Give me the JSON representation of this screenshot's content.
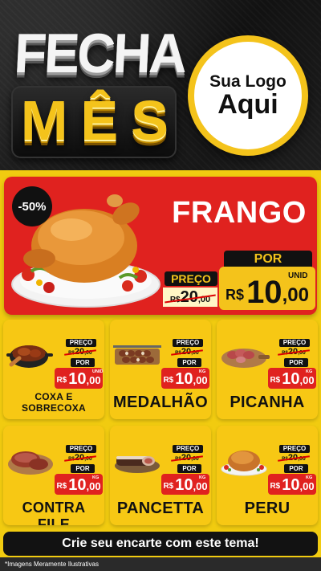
{
  "header": {
    "title_top": "FECHA",
    "title_bottom_letters": [
      "M",
      "Ê",
      "S"
    ],
    "logo_line1": "Sua Logo",
    "logo_line2": "Aqui"
  },
  "featured": {
    "discount": "-50%",
    "name": "FRANGO",
    "preco_label": "PREÇO",
    "old_currency": "R$",
    "old_int": "20",
    "old_cents": ",00",
    "por_label": "POR",
    "currency": "R$",
    "price_int": "10",
    "price_cents": ",00",
    "unit": "UNID",
    "image_icon": "roast-chicken-icon"
  },
  "products": [
    {
      "name": "COXA E SOBRECOXA",
      "preco_label": "PREÇO",
      "old_currency": "R$",
      "old_int": "20",
      "old_cents": ",00",
      "por_label": "POR",
      "currency": "R$",
      "price_int": "10",
      "price_cents": ",00",
      "unit": "UNID",
      "image_icon": "chicken-pot-icon"
    },
    {
      "name": "MEDALHÃO",
      "preco_label": "PREÇO",
      "old_currency": "R$",
      "old_int": "20",
      "old_cents": ",00",
      "por_label": "POR",
      "currency": "R$",
      "price_int": "10",
      "price_cents": ",00",
      "unit": "KG",
      "image_icon": "skewers-board-icon"
    },
    {
      "name": "PICANHA",
      "preco_label": "PREÇO",
      "old_currency": "R$",
      "old_int": "20",
      "old_cents": ",00",
      "por_label": "POR",
      "currency": "R$",
      "price_int": "10",
      "price_cents": ",00",
      "unit": "KG",
      "image_icon": "sliced-meat-icon"
    },
    {
      "name": "CONTRA FILE",
      "preco_label": "PREÇO",
      "old_currency": "R$",
      "old_int": "20",
      "old_cents": ",00",
      "por_label": "POR",
      "currency": "R$",
      "price_int": "10",
      "price_cents": ",00",
      "unit": "KG",
      "image_icon": "steak-icon"
    },
    {
      "name": "PANCETTA",
      "preco_label": "PREÇO",
      "old_currency": "R$",
      "old_int": "20",
      "old_cents": ",00",
      "por_label": "POR",
      "currency": "R$",
      "price_int": "10",
      "price_cents": ",00",
      "unit": "KG",
      "image_icon": "pancetta-icon"
    },
    {
      "name": "PERU",
      "preco_label": "PREÇO",
      "old_currency": "R$",
      "old_int": "20",
      "old_cents": ",00",
      "por_label": "POR",
      "currency": "R$",
      "price_int": "10",
      "price_cents": ",00",
      "unit": "KG",
      "image_icon": "roast-turkey-icon"
    }
  ],
  "footer": {
    "cta": "Crie seu encarte com este tema!",
    "disclaimer": "*Imagens Meramente Ilustrativas"
  },
  "colors": {
    "accent_yellow": "#f4c31b",
    "accent_red": "#e0221f",
    "dark": "#121212"
  }
}
